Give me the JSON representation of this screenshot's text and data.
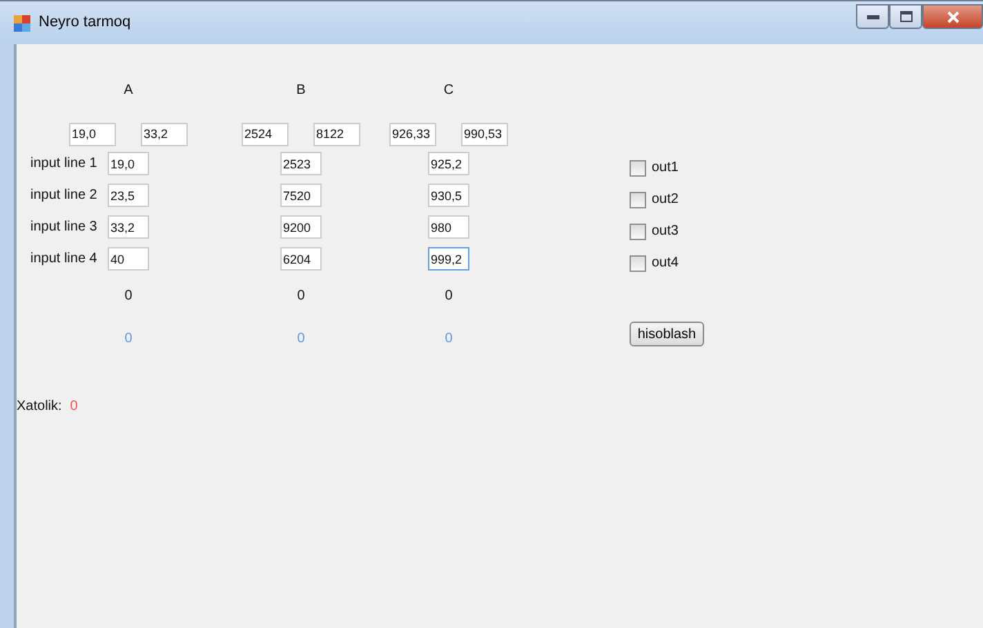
{
  "window": {
    "title": "Neyro tarmoq"
  },
  "columns": [
    {
      "header": "A",
      "range": [
        "19,0",
        "33,2"
      ],
      "inputs": [
        {
          "value": "19,0",
          "focused": false
        },
        {
          "value": "23,5",
          "focused": false
        },
        {
          "value": "33,2",
          "focused": false
        },
        {
          "value": "40",
          "focused": false
        }
      ],
      "output": "0",
      "result": "0"
    },
    {
      "header": "B",
      "range": [
        "2524",
        "8122"
      ],
      "inputs": [
        {
          "value": "2523",
          "focused": false
        },
        {
          "value": "7520",
          "focused": false
        },
        {
          "value": "9200",
          "focused": false
        },
        {
          "value": "6204",
          "focused": false
        }
      ],
      "output": "0",
      "result": "0"
    },
    {
      "header": "C",
      "range": [
        "926,33",
        "990,53"
      ],
      "inputs": [
        {
          "value": "925,2",
          "focused": false
        },
        {
          "value": "930,5",
          "focused": false
        },
        {
          "value": "980",
          "focused": false
        },
        {
          "value": "999,2",
          "focused": true
        }
      ],
      "output": "0",
      "result": "0"
    }
  ],
  "input_labels": [
    "input line 1",
    "input line 2",
    "input line 3",
    "input line 4"
  ],
  "outputs": [
    {
      "label": "out1",
      "checked": false
    },
    {
      "label": "out2",
      "checked": false
    },
    {
      "label": "out3",
      "checked": false
    },
    {
      "label": "out4",
      "checked": false
    }
  ],
  "button": "hisoblash",
  "error": {
    "label": "Xatolik:",
    "value": "0"
  }
}
